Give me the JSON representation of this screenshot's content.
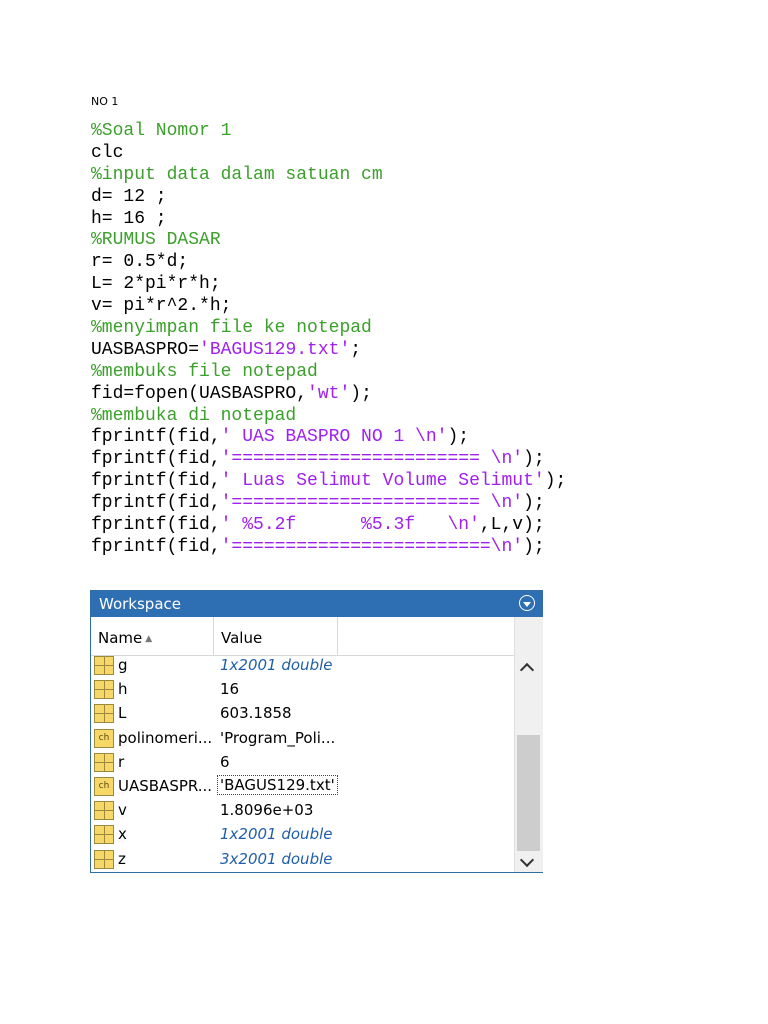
{
  "heading": "NO 1",
  "code": {
    "l1": "%Soal Nomor 1",
    "l2": "clc",
    "l3": "%input data dalam satuan cm",
    "l4": "d= 12 ;",
    "l5": "h= 16 ;",
    "l6": "%RUMUS DASAR",
    "l7": "r= 0.5*d;",
    "l8": "L= 2*pi*r*h;",
    "l9": "v= pi*r^2.*h;",
    "l10": "%menyimpan file ke notepad",
    "l11a": "UASBASPRO=",
    "l11b": "'BAGUS129.txt'",
    "l11c": ";",
    "l12": "%membuks file notepad",
    "l13a": "fid=fopen(UASBASPRO,",
    "l13b": "'wt'",
    "l13c": ");",
    "l14": "%membuka di notepad",
    "l15a": "fprintf(fid,",
    "l15b": "' UAS BASPRO NO 1 \\n'",
    "l15c": ");",
    "l16a": "fprintf(fid,",
    "l16b": "'======================= \\n'",
    "l16c": ");",
    "l17a": "fprintf(fid,",
    "l17b": "' Luas Selimut Volume Selimut'",
    "l17c": ");",
    "l18a": "fprintf(fid,",
    "l18b": "'======================= \\n'",
    "l18c": ");",
    "l19a": "fprintf(fid,",
    "l19b": "' %5.2f      %5.3f   \\n'",
    "l19c": ",L,v);",
    "l20a": "fprintf(fid,",
    "l20b": "'========================\\n'",
    "l20c": ");"
  },
  "workspace": {
    "title": "Workspace",
    "col_name": "Name",
    "col_value": "Value",
    "rows": [
      {
        "name": "g",
        "value": "1x2001 double",
        "icon": "matrix-icon"
      },
      {
        "name": "h",
        "value": "16",
        "icon": "matrix-icon"
      },
      {
        "name": "L",
        "value": "603.1858",
        "icon": "matrix-icon"
      },
      {
        "name": "polinomeri...",
        "value": "'Program_Poli...",
        "icon": "char-icon"
      },
      {
        "name": "r",
        "value": "6",
        "icon": "matrix-icon"
      },
      {
        "name": "UASBASPR...",
        "value": "'BAGUS129.txt'",
        "icon": "char-icon"
      },
      {
        "name": "v",
        "value": "1.8096e+03",
        "icon": "matrix-icon"
      },
      {
        "name": "x",
        "value": "1x2001 double",
        "icon": "matrix-icon"
      },
      {
        "name": "z",
        "value": "3x2001 double",
        "icon": "matrix-icon"
      }
    ],
    "char_icon_text": "ch"
  }
}
